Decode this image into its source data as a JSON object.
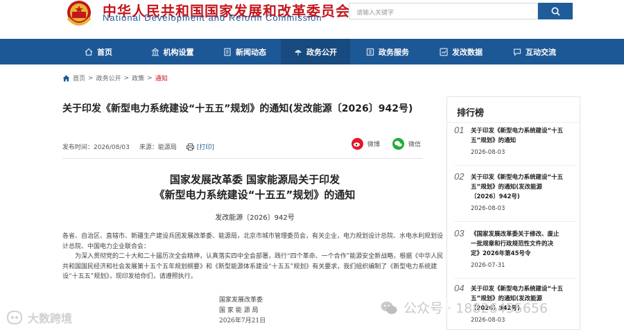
{
  "header": {
    "org_name_cn": "中华人民共和国国家发展和改革委员会",
    "org_name_en": "National Development and Reform Commission",
    "search_placeholder": "请输入关键字"
  },
  "nav": {
    "items": [
      {
        "label": "首页",
        "icon": "home-icon"
      },
      {
        "label": "机构设置",
        "icon": "building-icon"
      },
      {
        "label": "新闻动态",
        "icon": "news-icon"
      },
      {
        "label": "政务公开",
        "icon": "umbrella-icon",
        "active": true
      },
      {
        "label": "政务服务",
        "icon": "service-icon"
      },
      {
        "label": "发改数据",
        "icon": "data-icon"
      },
      {
        "label": "互动交流",
        "icon": "chat-icon"
      }
    ]
  },
  "breadcrumb": {
    "items": [
      "首页",
      "政务公开",
      "政策",
      "通知"
    ]
  },
  "article": {
    "title": "关于印发《新型电力系统建设“十五五”规划》的通知(发改能源〔2026〕942号)",
    "publish_label": "发布时间：2026/08/03",
    "source_label": "来源：能源局",
    "print_label": "[打印]",
    "share": {
      "weibo": "微博",
      "wechat": "微信"
    },
    "doc_title_1": "国家发展改革委 国家能源局关于印发",
    "doc_title_2": "《新型电力系统建设“十五五”规划》的通知",
    "doc_number": "发改能源〔2026〕942号",
    "recipients": "各省、自治区、直辖市、新疆生产建设兵团发展改革委、能源局，北京市城市管理委员会，有关企业，电力规划设计总院、水电水利规划设计总院、中国电力企业联合会：",
    "body": "为深入贯彻党的二十大和二十届历次全会精神，认真落实四中全会部署，践行“四个革命、一个合作”能源安全新战略，根据《中华人民共和国国民经济和社会发展第十五个五年规划纲要》和《新型能源体系建设“十五五”规划》有关要求，我们组织编制了《新型电力系统建设“十五五”规划》，现印发给你们，请遵照执行。",
    "sign_1": "国家发展改革委",
    "sign_2": "国 家 能 源 局",
    "sign_date": "2026年7月21日"
  },
  "sidebar": {
    "title": "排行榜",
    "items": [
      {
        "no": "01",
        "line1": "关于印发《新型电力系统建设“十五",
        "line2": "五”规划》的通知",
        "line3": "",
        "date": "2026-08-03"
      },
      {
        "no": "02",
        "line1": "关于印发《新型电力系统建设“十五",
        "line2": "五”规划》的通知(发改能源",
        "line3": "〔2026〕942号)",
        "date": "2026-08-03"
      },
      {
        "no": "03",
        "line1": "《国家发展改革委关于修改、废止",
        "line2": "一批规章和行政规范性文件的决",
        "line3": "定》2026年第45号令",
        "date": "2026-07-31"
      },
      {
        "no": "04",
        "line1": "关于印发《新型电力系统建设“十五",
        "line2": "五”规划》的通知(发改能源",
        "line3": "〔2026〕942号)",
        "date": "2026-08-03"
      }
    ]
  },
  "watermarks": {
    "left": "大数跨境",
    "right": "公众号 · 18826455656"
  }
}
